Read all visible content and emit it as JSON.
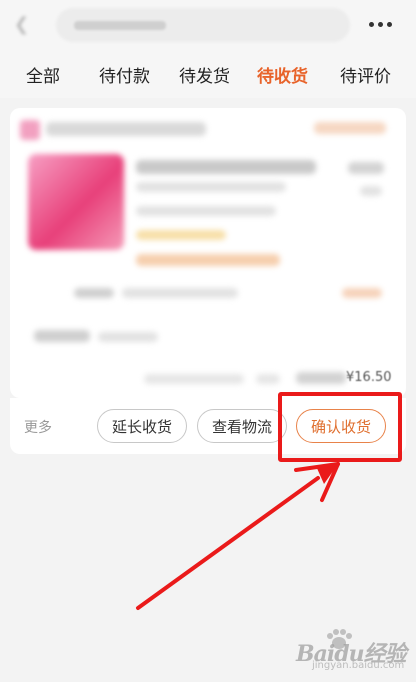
{
  "header": {
    "back_icon": "chevron-left-icon",
    "more_icon": "more-dots-icon"
  },
  "tabs": [
    {
      "label": "全部",
      "active": false
    },
    {
      "label": "待付款",
      "active": false
    },
    {
      "label": "待发货",
      "active": false
    },
    {
      "label": "待收货",
      "active": true
    },
    {
      "label": "待评价",
      "active": false
    }
  ],
  "order": {
    "total": "¥16.50"
  },
  "actions": {
    "more_label": "更多",
    "extend_label": "延长收货",
    "logistics_label": "查看物流",
    "confirm_label": "确认收货"
  },
  "colors": {
    "accent": "#e8632a",
    "annotation": "#ea1a1a"
  },
  "watermark": {
    "text": "Baidu经验",
    "sub": "jingyan.baidu.com"
  }
}
